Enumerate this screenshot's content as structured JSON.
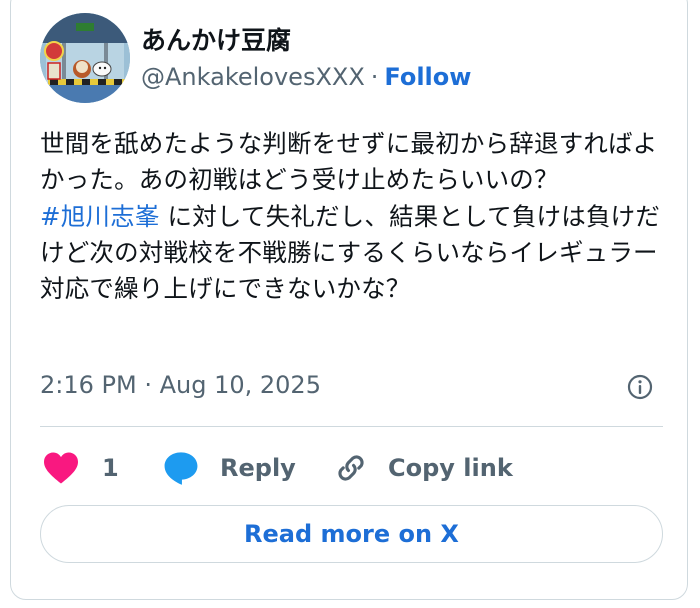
{
  "author": {
    "display_name": "あんかけ豆腐",
    "handle": "@AnkakelovesXXX",
    "separator": "·",
    "follow_label": "Follow"
  },
  "tweet": {
    "text_before": "世間を舐めたような判断をせずに最初から辞退すればよかった。あの初戦はどう受け止めたらいいの？",
    "hashtag": "#旭川志峯",
    "text_after": " に対して失礼だし、結果として負けは負けだけど次の対戦校を不戦勝にするくらいならイレギュラー対応で繰り上げにできないかな？",
    "timestamp": "2:16 PM · Aug 10, 2025"
  },
  "actions": {
    "like_count": "1",
    "reply_label": "Reply",
    "copy_link_label": "Copy link"
  },
  "read_more_label": "Read more on X",
  "colors": {
    "accent": "#1d6ed6",
    "heart": "#f91880",
    "reply_bubble": "#1d9bf0",
    "muted": "#536471",
    "border": "#cfd9de"
  },
  "icons": [
    "avatar-image",
    "info-icon",
    "heart-icon",
    "reply-bubble-icon",
    "link-icon"
  ]
}
